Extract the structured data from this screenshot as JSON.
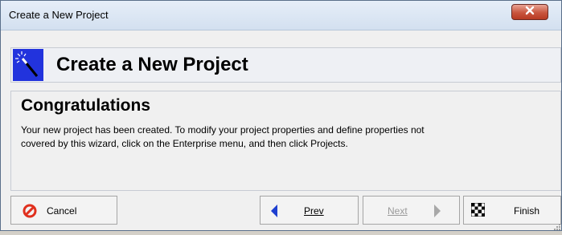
{
  "window": {
    "title": "Create a New Project",
    "close_icon": "close-x-icon"
  },
  "header": {
    "title": "Create a New Project",
    "icon": "magic-wand-icon"
  },
  "content": {
    "heading": "Congratulations",
    "body_line1": "Your new project has been created.  To modify your project properties and define properties not",
    "body_line2": "covered by this wizard, click on the Enterprise menu, and then click Projects."
  },
  "buttons": {
    "cancel": {
      "label": "Cancel",
      "icon": "no-entry-icon",
      "enabled": true
    },
    "prev": {
      "label": "Prev",
      "icon": "arrow-left-icon",
      "enabled": true
    },
    "next": {
      "label": "Next",
      "icon": "arrow-right-icon",
      "enabled": false
    },
    "finish": {
      "label": "Finish",
      "icon": "checkered-flag-icon",
      "enabled": true
    }
  },
  "colors": {
    "wand_bg": "#2233dd",
    "cancel_icon": "#e0301e",
    "prev_arrow": "#1e3fd0",
    "next_arrow_disabled": "#a8a8a8"
  }
}
